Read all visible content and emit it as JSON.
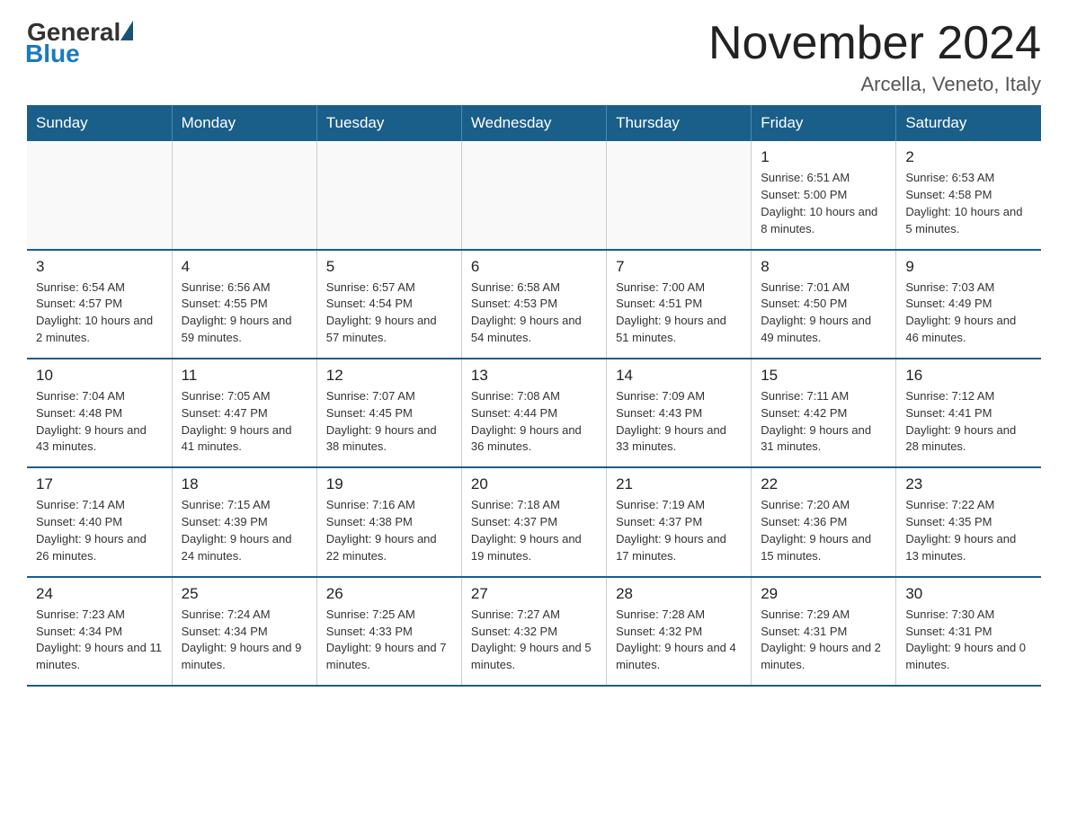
{
  "header": {
    "logo_general": "General",
    "logo_blue": "Blue",
    "title": "November 2024",
    "subtitle": "Arcella, Veneto, Italy"
  },
  "weekdays": [
    "Sunday",
    "Monday",
    "Tuesday",
    "Wednesday",
    "Thursday",
    "Friday",
    "Saturday"
  ],
  "weeks": [
    [
      {
        "day": "",
        "info": ""
      },
      {
        "day": "",
        "info": ""
      },
      {
        "day": "",
        "info": ""
      },
      {
        "day": "",
        "info": ""
      },
      {
        "day": "",
        "info": ""
      },
      {
        "day": "1",
        "info": "Sunrise: 6:51 AM\nSunset: 5:00 PM\nDaylight: 10 hours and 8 minutes."
      },
      {
        "day": "2",
        "info": "Sunrise: 6:53 AM\nSunset: 4:58 PM\nDaylight: 10 hours and 5 minutes."
      }
    ],
    [
      {
        "day": "3",
        "info": "Sunrise: 6:54 AM\nSunset: 4:57 PM\nDaylight: 10 hours and 2 minutes."
      },
      {
        "day": "4",
        "info": "Sunrise: 6:56 AM\nSunset: 4:55 PM\nDaylight: 9 hours and 59 minutes."
      },
      {
        "day": "5",
        "info": "Sunrise: 6:57 AM\nSunset: 4:54 PM\nDaylight: 9 hours and 57 minutes."
      },
      {
        "day": "6",
        "info": "Sunrise: 6:58 AM\nSunset: 4:53 PM\nDaylight: 9 hours and 54 minutes."
      },
      {
        "day": "7",
        "info": "Sunrise: 7:00 AM\nSunset: 4:51 PM\nDaylight: 9 hours and 51 minutes."
      },
      {
        "day": "8",
        "info": "Sunrise: 7:01 AM\nSunset: 4:50 PM\nDaylight: 9 hours and 49 minutes."
      },
      {
        "day": "9",
        "info": "Sunrise: 7:03 AM\nSunset: 4:49 PM\nDaylight: 9 hours and 46 minutes."
      }
    ],
    [
      {
        "day": "10",
        "info": "Sunrise: 7:04 AM\nSunset: 4:48 PM\nDaylight: 9 hours and 43 minutes."
      },
      {
        "day": "11",
        "info": "Sunrise: 7:05 AM\nSunset: 4:47 PM\nDaylight: 9 hours and 41 minutes."
      },
      {
        "day": "12",
        "info": "Sunrise: 7:07 AM\nSunset: 4:45 PM\nDaylight: 9 hours and 38 minutes."
      },
      {
        "day": "13",
        "info": "Sunrise: 7:08 AM\nSunset: 4:44 PM\nDaylight: 9 hours and 36 minutes."
      },
      {
        "day": "14",
        "info": "Sunrise: 7:09 AM\nSunset: 4:43 PM\nDaylight: 9 hours and 33 minutes."
      },
      {
        "day": "15",
        "info": "Sunrise: 7:11 AM\nSunset: 4:42 PM\nDaylight: 9 hours and 31 minutes."
      },
      {
        "day": "16",
        "info": "Sunrise: 7:12 AM\nSunset: 4:41 PM\nDaylight: 9 hours and 28 minutes."
      }
    ],
    [
      {
        "day": "17",
        "info": "Sunrise: 7:14 AM\nSunset: 4:40 PM\nDaylight: 9 hours and 26 minutes."
      },
      {
        "day": "18",
        "info": "Sunrise: 7:15 AM\nSunset: 4:39 PM\nDaylight: 9 hours and 24 minutes."
      },
      {
        "day": "19",
        "info": "Sunrise: 7:16 AM\nSunset: 4:38 PM\nDaylight: 9 hours and 22 minutes."
      },
      {
        "day": "20",
        "info": "Sunrise: 7:18 AM\nSunset: 4:37 PM\nDaylight: 9 hours and 19 minutes."
      },
      {
        "day": "21",
        "info": "Sunrise: 7:19 AM\nSunset: 4:37 PM\nDaylight: 9 hours and 17 minutes."
      },
      {
        "day": "22",
        "info": "Sunrise: 7:20 AM\nSunset: 4:36 PM\nDaylight: 9 hours and 15 minutes."
      },
      {
        "day": "23",
        "info": "Sunrise: 7:22 AM\nSunset: 4:35 PM\nDaylight: 9 hours and 13 minutes."
      }
    ],
    [
      {
        "day": "24",
        "info": "Sunrise: 7:23 AM\nSunset: 4:34 PM\nDaylight: 9 hours and 11 minutes."
      },
      {
        "day": "25",
        "info": "Sunrise: 7:24 AM\nSunset: 4:34 PM\nDaylight: 9 hours and 9 minutes."
      },
      {
        "day": "26",
        "info": "Sunrise: 7:25 AM\nSunset: 4:33 PM\nDaylight: 9 hours and 7 minutes."
      },
      {
        "day": "27",
        "info": "Sunrise: 7:27 AM\nSunset: 4:32 PM\nDaylight: 9 hours and 5 minutes."
      },
      {
        "day": "28",
        "info": "Sunrise: 7:28 AM\nSunset: 4:32 PM\nDaylight: 9 hours and 4 minutes."
      },
      {
        "day": "29",
        "info": "Sunrise: 7:29 AM\nSunset: 4:31 PM\nDaylight: 9 hours and 2 minutes."
      },
      {
        "day": "30",
        "info": "Sunrise: 7:30 AM\nSunset: 4:31 PM\nDaylight: 9 hours and 0 minutes."
      }
    ]
  ]
}
